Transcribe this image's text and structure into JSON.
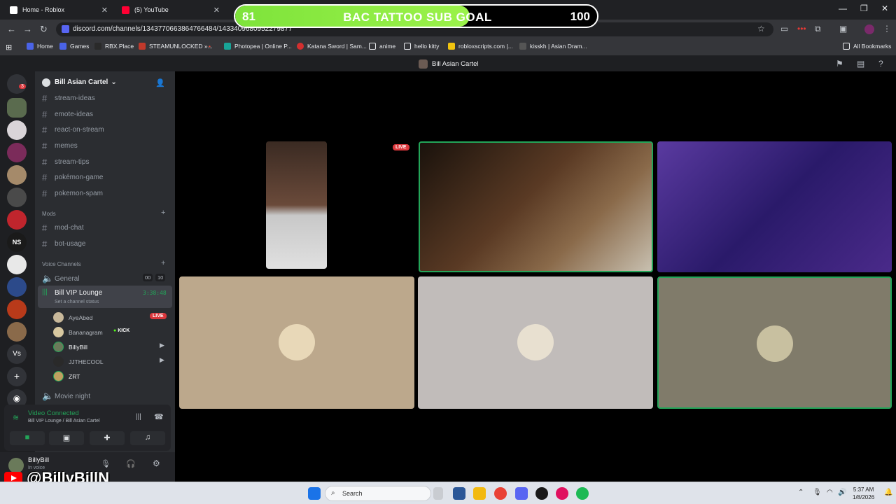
{
  "browser": {
    "tabs": [
      {
        "label": "Home - Roblox",
        "color": "#ffffff"
      },
      {
        "label": "(5) YouTube",
        "color": "#ff0033"
      }
    ],
    "url": "discord.com/channels/1343770663864766484/1433409680952279877",
    "bookmarks": [
      "Home",
      "Games",
      "RBX.Place",
      "STEAMUNLOCKED »...",
      "Photopea | Online P...",
      "Katana Sword | Sam...",
      "anime",
      "hello kitty",
      "robloxscripts.com |...",
      "kisskh | Asian Dram...",
      "All Bookmarks"
    ]
  },
  "goal": {
    "current": "81",
    "title": "BAC TATTOO SUB GOAL",
    "max": "100",
    "progress": 0.81
  },
  "discord": {
    "header_title": "Bill Asian Cartel",
    "server_name": "Bill Asian Cartel",
    "mention_badge": "3",
    "channels": [
      "stream-ideas",
      "emote-ideas",
      "react-on-stream",
      "memes",
      "stream-tips",
      "pokémon-game",
      "pokemon-spam"
    ],
    "mods_category": "Mods",
    "mod_channels": [
      "mod-chat",
      "bot-usage"
    ],
    "voice_category": "Voice Channels",
    "general": {
      "name": "General",
      "count_a": "00",
      "count_b": "10"
    },
    "vip": {
      "name": "Bill VIP Lounge",
      "timer": "3:38:48",
      "status": "Set a channel status"
    },
    "voice_users": [
      {
        "name": "AyeAbed",
        "tag": "LIVE"
      },
      {
        "name": "Bananagram",
        "tag": "KICK"
      },
      {
        "name": "BillyBill",
        "tag": ""
      },
      {
        "name": "JJTHECOOL",
        "tag": ""
      },
      {
        "name": "ZRT",
        "tag": ""
      }
    ],
    "movie": "Movie night",
    "connection": {
      "status": "Video Connected",
      "channel": "Bill VIP Lounge / Bill Asian Cartel"
    },
    "user": {
      "name": "BillyBill",
      "status": "In voice"
    },
    "live_badge": "LIVE"
  },
  "watermark": "@BillyBillN",
  "taskbar": {
    "search": "Search",
    "time": "5:37 AM",
    "date": "1/8/2026"
  }
}
